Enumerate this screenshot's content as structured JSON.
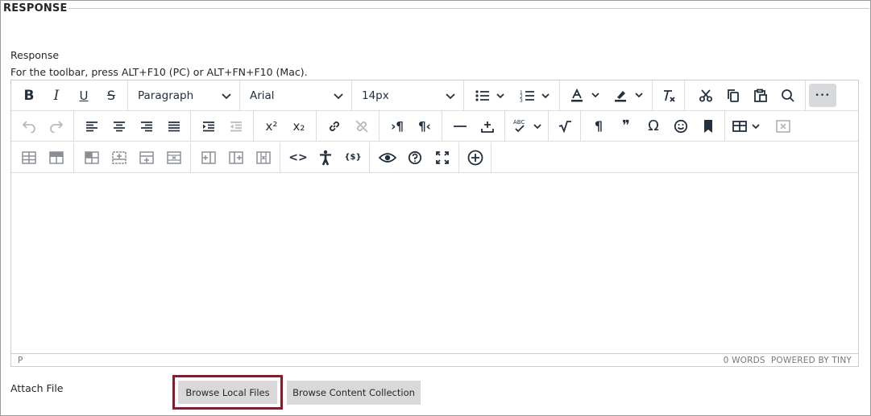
{
  "section": {
    "legend": "RESPONSE"
  },
  "field": {
    "label": "Response",
    "toolbar_hint": "For the toolbar, press ALT+F10 (PC) or ALT+FN+F10 (Mac)."
  },
  "toolbar": {
    "block_format": "Paragraph",
    "font_family": "Arial",
    "font_size": "14px",
    "icons_row1": [
      "bold-icon",
      "italic-icon",
      "underline-icon",
      "strikethrough-icon",
      "bullet-list-icon",
      "numbered-list-icon",
      "text-color-icon",
      "highlight-icon",
      "clear-format-icon",
      "cut-icon",
      "copy-icon",
      "paste-icon",
      "find-icon",
      "more-icon"
    ],
    "icons_row2": [
      "undo-icon",
      "redo-icon",
      "align-left-icon",
      "align-center-icon",
      "align-right-icon",
      "justify-icon",
      "indent-icon",
      "outdent-icon",
      "superscript-icon",
      "subscript-icon",
      "link-icon",
      "unlink-icon",
      "ltr-icon",
      "rtl-icon",
      "horizontal-rule-icon",
      "nonbreaking-icon",
      "spellcheck-icon",
      "math-icon",
      "paragraph-mark-icon",
      "blockquote-icon",
      "special-char-icon",
      "emoticon-icon",
      "bookmark-icon",
      "table-icon",
      "delete-table-icon"
    ],
    "icons_row3": [
      "table-row-props-icon",
      "table-cell-props-icon",
      "table-cell-header-icon",
      "insert-row-before-icon",
      "insert-row-after-icon",
      "delete-row-icon",
      "insert-col-before-icon",
      "insert-col-after-icon",
      "delete-col-icon",
      "code-icon",
      "accessibility-icon",
      "template-icon",
      "preview-icon",
      "help-icon",
      "fullscreen-icon",
      "add-content-icon"
    ],
    "bold_glyph": "B",
    "italic_glyph": "I",
    "underline_glyph": "U",
    "strike_glyph": "S",
    "omega_glyph": "Ω",
    "pilcrow_glyph": "¶",
    "quote_glyph": "❞",
    "code_glyph": "<>",
    "braces_glyph": "{$}",
    "sup_glyph": "x²",
    "sub_glyph": "x₂",
    "abc_glyph": "ABC",
    "more_glyph": "•••"
  },
  "statusbar": {
    "path": "P",
    "words": "0 WORDS",
    "powered": "POWERED BY TINY"
  },
  "attach": {
    "label": "Attach File",
    "browse_local": "Browse Local Files",
    "browse_collection": "Browse Content Collection"
  },
  "colors": {
    "highlight_border": "#8b1a2b",
    "button_bg": "#d9d9d9",
    "icon": "#222f3e",
    "disabled_icon": "#b6b9be"
  }
}
